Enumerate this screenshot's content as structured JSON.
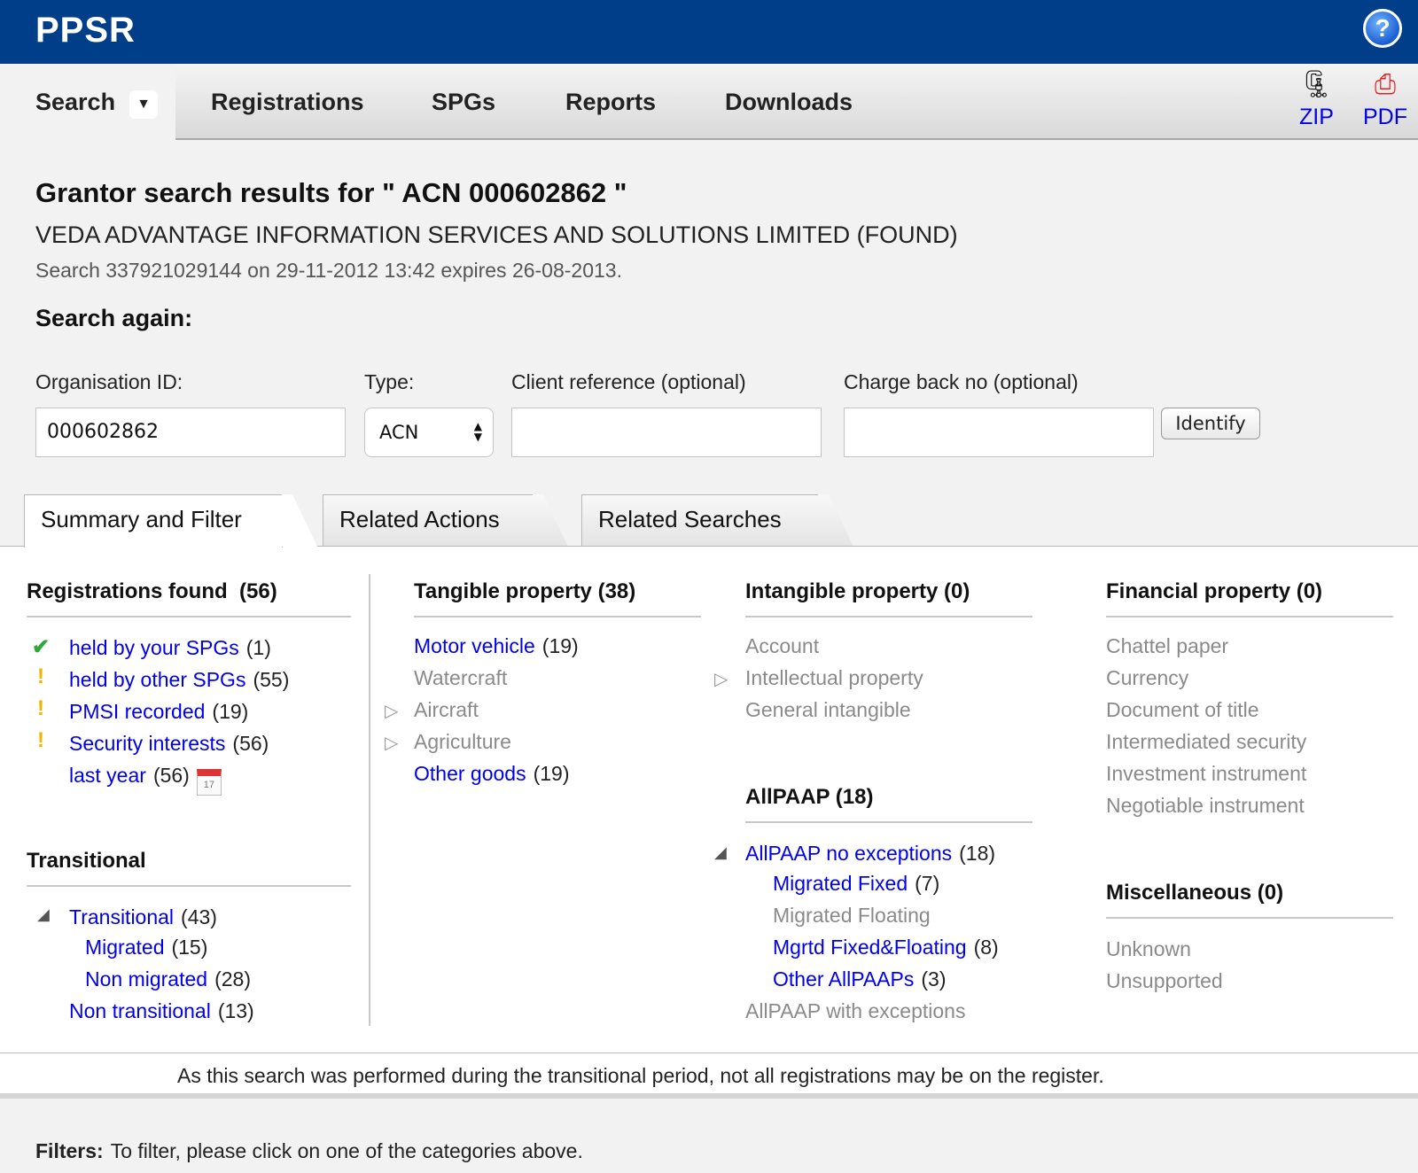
{
  "app": {
    "brand": "PPSR",
    "help": "?"
  },
  "nav": {
    "items": [
      "Search",
      "Registrations",
      "SPGs",
      "Reports",
      "Downloads"
    ],
    "downloads": [
      {
        "icon": "zip-archive-icon",
        "label": "ZIP"
      },
      {
        "icon": "pdf-file-icon",
        "label": "PDF"
      }
    ]
  },
  "result": {
    "title": "Grantor search results for \" ACN 000602862 \"",
    "entity": "VEDA ADVANTAGE INFORMATION SERVICES AND SOLUTIONS LIMITED (FOUND)",
    "meta": "Search 337921029144 on 29-11-2012 13:42 expires 26-08-2013."
  },
  "search_again": {
    "heading": "Search again:",
    "org_label": "Organisation ID:",
    "org_value": "000602862",
    "type_label": "Type:",
    "type_value": "ACN",
    "client_label": "Client reference (optional)",
    "client_value": "",
    "charge_label": "Charge back no (optional)",
    "charge_value": "",
    "button": "Identify"
  },
  "tabs": [
    "Summary and Filter",
    "Related Actions",
    "Related Searches"
  ],
  "registrations": {
    "heading": "Registrations found",
    "count": "(56)",
    "items": [
      {
        "label": "held by your SPGs",
        "count": "(1)",
        "marker": "✔"
      },
      {
        "label": "held by other SPGs",
        "count": "(55)",
        "marker": "!"
      },
      {
        "label": "PMSI recorded",
        "count": "(19)",
        "marker": "!"
      },
      {
        "label": "Security interests",
        "count": "(56)",
        "marker": "!"
      },
      {
        "label": "last year",
        "count": "(56)",
        "marker": ""
      }
    ],
    "calendar_day": "17"
  },
  "transitional": {
    "heading": "Transitional",
    "items": [
      {
        "label": "Transitional",
        "count": "(43)"
      },
      {
        "label": "Migrated",
        "count": "(15)"
      },
      {
        "label": "Non migrated",
        "count": "(28)"
      },
      {
        "label": "Non transitional",
        "count": "(13)"
      }
    ]
  },
  "tangible": {
    "heading": "Tangible property (38)",
    "items": [
      {
        "label": "Motor vehicle",
        "count": "(19)"
      },
      {
        "label": "Watercraft",
        "count": ""
      },
      {
        "label": "Aircraft",
        "count": ""
      },
      {
        "label": "Agriculture",
        "count": ""
      },
      {
        "label": "Other goods",
        "count": "(19)"
      }
    ]
  },
  "intangible": {
    "heading": "Intangible property (0)",
    "items": [
      "Account",
      "Intellectual property",
      "General intangible"
    ]
  },
  "allpaap": {
    "heading": "AllPAAP (18)",
    "items": [
      {
        "label": "AllPAAP no exceptions",
        "count": "(18)"
      },
      {
        "label": "Migrated Fixed",
        "count": "(7)"
      },
      {
        "label": "Migrated Floating",
        "count": ""
      },
      {
        "label": "Mgrtd Fixed&Floating",
        "count": "(8)"
      },
      {
        "label": "Other AllPAAPs",
        "count": "(3)"
      },
      {
        "label": "AllPAAP with exceptions",
        "count": ""
      }
    ]
  },
  "financial": {
    "heading": "Financial property (0)",
    "items": [
      "Chattel paper",
      "Currency",
      "Document of title",
      "Intermediated security",
      "Investment instrument",
      "Negotiable instrument"
    ]
  },
  "misc": {
    "heading": "Miscellaneous (0)",
    "items": [
      "Unknown",
      "Unsupported"
    ]
  },
  "footer": {
    "note": "As this search was performed during the transitional period, not all registrations may be on the register.",
    "filters_label": "Filters:",
    "filters_text": "To filter, please click on one of the categories above."
  },
  "colors": {
    "header": "#003e8a",
    "link": "#0000ee",
    "check": "#2eaa3c",
    "warn": "#f2b400",
    "muted": "#8a8a8a"
  }
}
